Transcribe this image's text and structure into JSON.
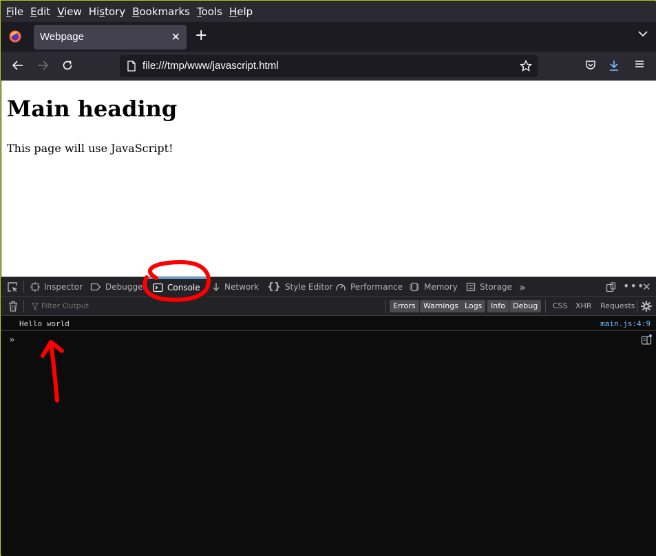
{
  "menubar": {
    "items": [
      {
        "u": "F",
        "rest": "ile"
      },
      {
        "u": "E",
        "rest": "dit"
      },
      {
        "u": "V",
        "rest": "iew"
      },
      {
        "pre": "Hi",
        "u": "s",
        "rest": "tory"
      },
      {
        "u": "B",
        "rest": "ookmarks"
      },
      {
        "u": "T",
        "rest": "ools"
      },
      {
        "u": "H",
        "rest": "elp"
      }
    ]
  },
  "tab": {
    "title": "Webpage",
    "close": "✕"
  },
  "urlbar": {
    "url": "file:///tmp/www/javascript.html"
  },
  "page": {
    "heading": "Main heading",
    "paragraph": "This page will use JavaScript!"
  },
  "devtools": {
    "tabs": [
      "Inspector",
      "Debugger",
      "Console",
      "Network",
      "Style Editor",
      "Performance",
      "Memory",
      "Storage"
    ],
    "selected_tab": "Console",
    "filter_placeholder": "Filter Output",
    "level_buttons": [
      "Errors",
      "Warnings",
      "Logs",
      "Info",
      "Debug"
    ],
    "type_buttons": [
      "CSS",
      "XHR",
      "Requests"
    ],
    "console_messages": [
      {
        "text": "Hello world",
        "source": "main.js:4:9"
      }
    ],
    "prompt": "»"
  },
  "colors": {
    "accent": "#75bfff",
    "annotation": "#ff0000"
  }
}
